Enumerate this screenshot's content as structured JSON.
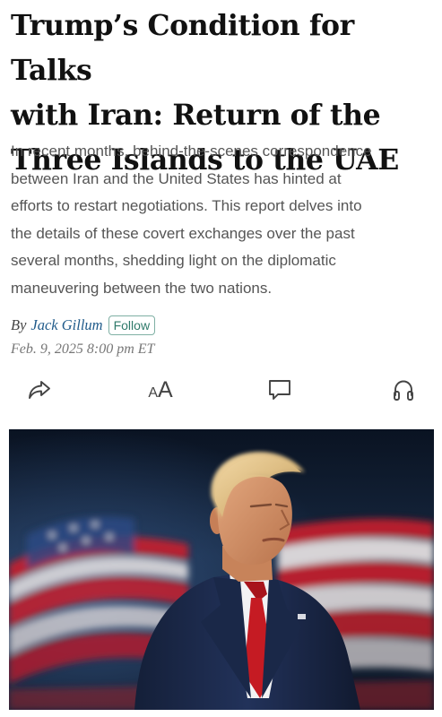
{
  "article": {
    "headline_lines": [
      "Trump’s Condition for Talks",
      "with Iran: Return of the",
      "Three Islands to the UAE"
    ],
    "dek_lines": [
      "In recent months, behind-the-scenes correspondence",
      "between Iran and the United States has hinted at",
      "efforts to restart negotiations. This report delves into",
      "the details of these covert exchanges over the past",
      "several months, shedding light on the diplomatic",
      "maneuvering between the two nations."
    ],
    "byline_prefix": "By",
    "author": "Jack Gillum",
    "follow_label": "Follow",
    "date": "Feb. 9, 2025 8:00 pm ET"
  },
  "toolbar": {
    "share_icon": "share-arrow-icon",
    "text_size_label_small": "A",
    "text_size_label_large": "A",
    "comment_icon": "comment-bubble-icon",
    "listen_icon": "headphones-icon"
  },
  "photo": {
    "subject": "man in navy suit, white shirt and red tie in front of a US flag backdrop",
    "colors": {
      "backdrop": "#0e1a2c",
      "flag_red": "#c8202e",
      "flag_white": "#e9e4e4",
      "suit": "#1b2a4a",
      "tie": "#b81c22"
    }
  },
  "colors": {
    "text": "#111111",
    "dek": "#555555",
    "author_link": "#1f5a8a",
    "follow": "#2f7a6a",
    "date": "#777777",
    "icon": "#444444"
  }
}
